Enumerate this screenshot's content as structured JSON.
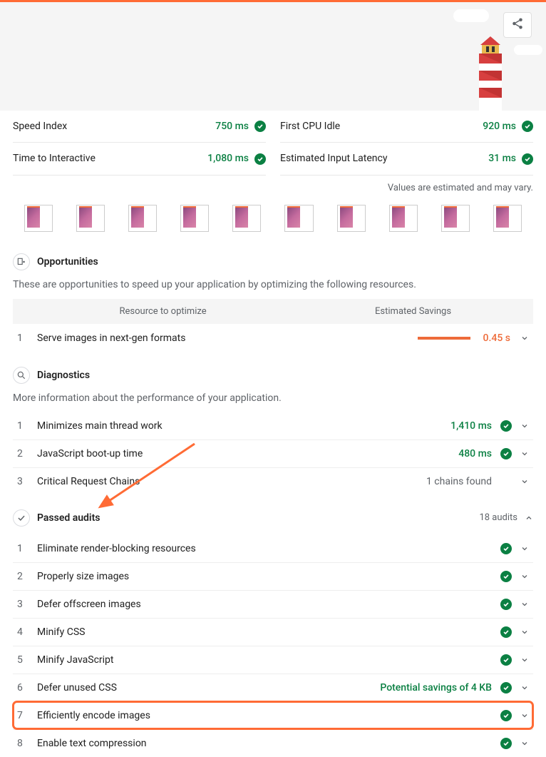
{
  "hero": {
    "share_icon": "share-icon"
  },
  "metrics": {
    "left": [
      {
        "label": "Speed Index",
        "value": "750 ms"
      },
      {
        "label": "Time to Interactive",
        "value": "1,080 ms"
      }
    ],
    "right": [
      {
        "label": "First CPU Idle",
        "value": "920 ms"
      },
      {
        "label": "Estimated Input Latency",
        "value": "31 ms"
      }
    ]
  },
  "note": "Values are estimated and may vary.",
  "filmstrip_count": 10,
  "opportunities": {
    "title": "Opportunities",
    "desc": "These are opportunities to speed up your application by optimizing the following resources.",
    "col_left": "Resource to optimize",
    "col_right": "Estimated Savings",
    "rows": [
      {
        "num": "1",
        "label": "Serve images in next-gen formats",
        "savings": "0.45 s"
      }
    ]
  },
  "diagnostics": {
    "title": "Diagnostics",
    "desc": "More information about the performance of your application.",
    "rows": [
      {
        "num": "1",
        "label": "Minimizes main thread work",
        "value": "1,410 ms",
        "pass": true
      },
      {
        "num": "2",
        "label": "JavaScript boot-up time",
        "value": "480 ms",
        "pass": true
      },
      {
        "num": "3",
        "label": "Critical Request Chains",
        "value": "1 chains found",
        "pass": false
      }
    ]
  },
  "passed": {
    "title": "Passed audits",
    "count": "18 audits",
    "rows": [
      {
        "num": "1",
        "label": "Eliminate render-blocking resources",
        "extra": ""
      },
      {
        "num": "2",
        "label": "Properly size images",
        "extra": ""
      },
      {
        "num": "3",
        "label": "Defer offscreen images",
        "extra": ""
      },
      {
        "num": "4",
        "label": "Minify CSS",
        "extra": ""
      },
      {
        "num": "5",
        "label": "Minify JavaScript",
        "extra": ""
      },
      {
        "num": "6",
        "label": "Defer unused CSS",
        "extra": "Potential savings of 4 KB"
      },
      {
        "num": "7",
        "label": "Efficiently encode images",
        "extra": "",
        "highlight": true
      },
      {
        "num": "8",
        "label": "Enable text compression",
        "extra": ""
      }
    ]
  }
}
